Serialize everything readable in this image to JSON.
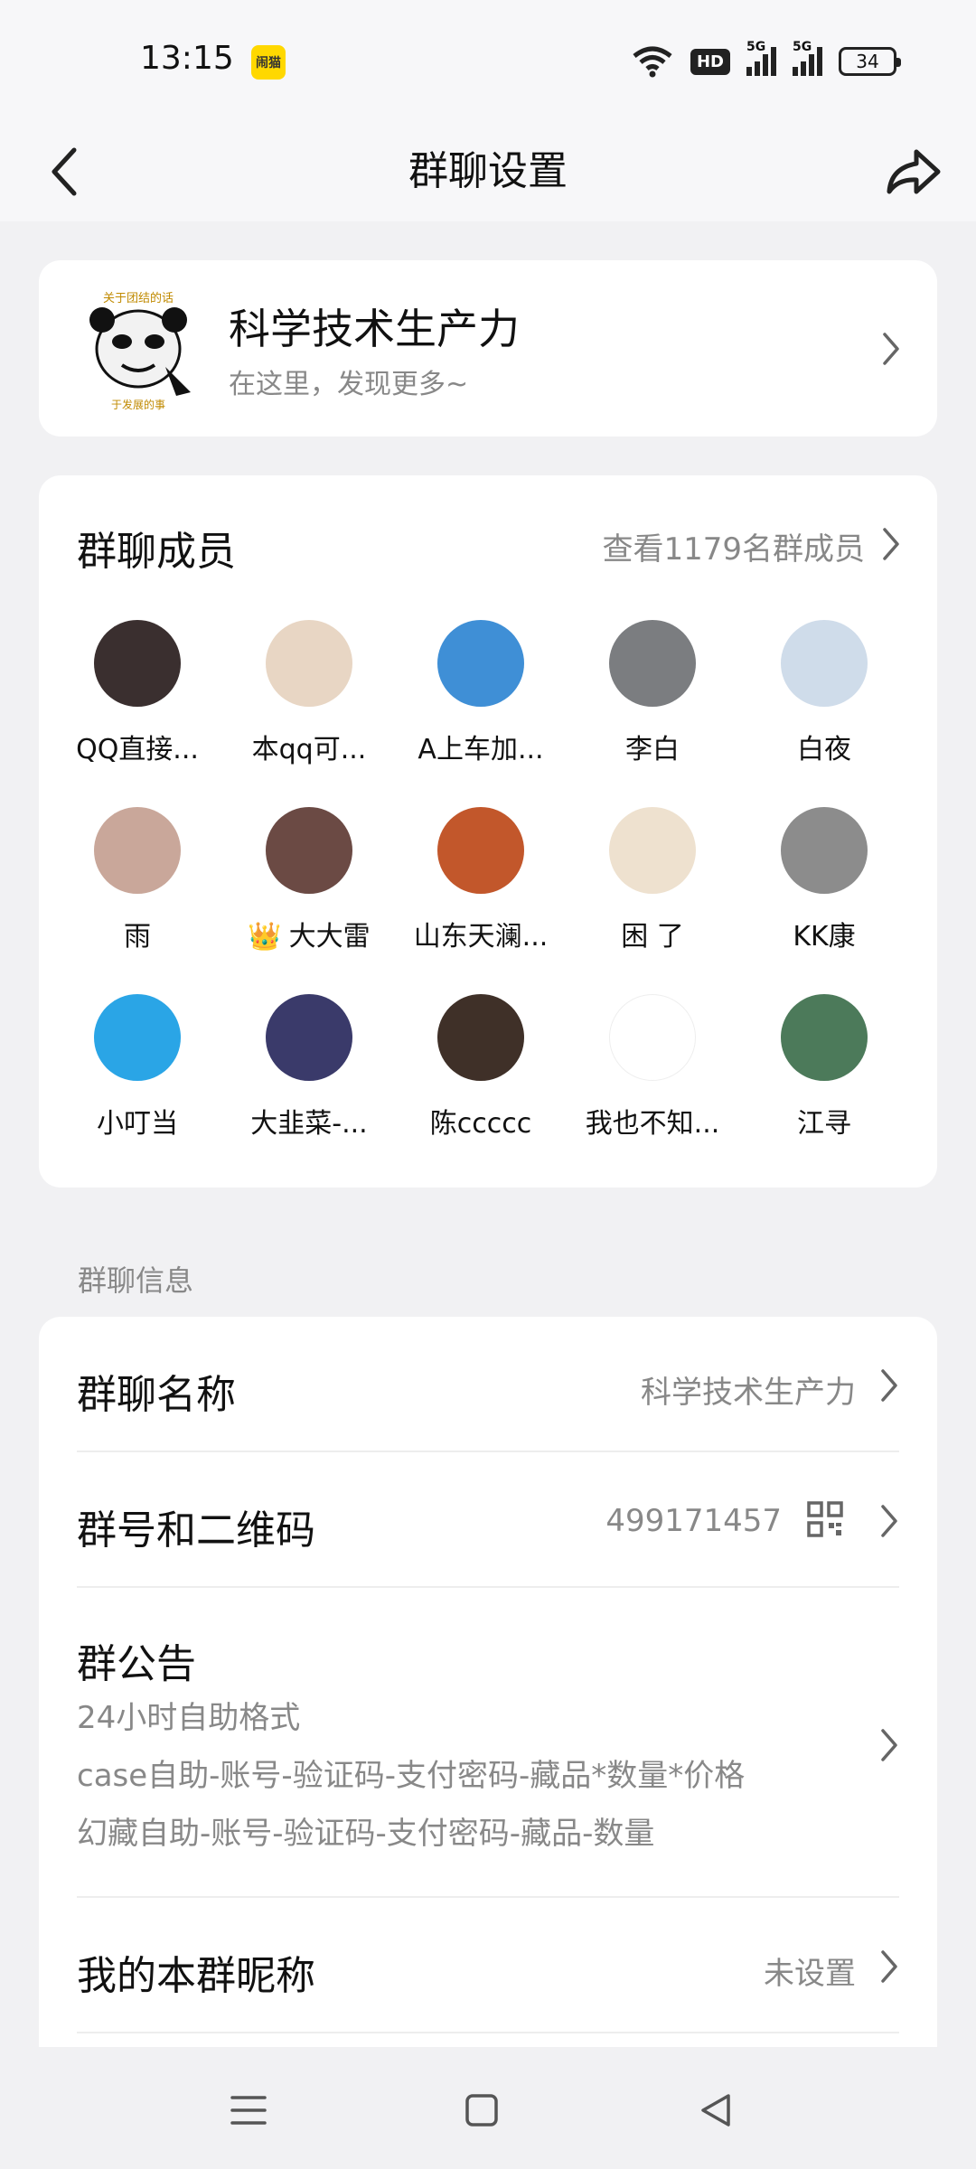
{
  "status": {
    "time": "13:15",
    "notif_badge": "闹猫",
    "hd": "HD",
    "signal1": "5G",
    "signal2": "5G",
    "battery": "34"
  },
  "header": {
    "title": "群聊设置"
  },
  "group": {
    "name": "科学技术生产力",
    "desc": "在这里，发现更多~",
    "avatar_text_top": "关于团结的话",
    "avatar_text_bottom": "于发展的事"
  },
  "members": {
    "title": "群聊成员",
    "view_all": "查看1179名群成员",
    "list": [
      {
        "name": "QQ直接...",
        "color": "#3a2f2f"
      },
      {
        "name": "本qq可...",
        "color": "#e8d6c4"
      },
      {
        "name": "A上车加...",
        "color": "#3f8fd6"
      },
      {
        "name": "李白",
        "color": "#7b7d80"
      },
      {
        "name": "白夜",
        "color": "#cfdcea"
      },
      {
        "name": "雨",
        "color": "#c9a79a"
      },
      {
        "name": "大大雷",
        "crown": "👑",
        "color": "#6b4a44"
      },
      {
        "name": "山东天澜...",
        "color": "#c2572b"
      },
      {
        "name": "困   了",
        "color": "#eee1cf"
      },
      {
        "name": "KK康",
        "color": "#8c8c8c"
      },
      {
        "name": "小叮当",
        "color": "#2aa5e6"
      },
      {
        "name": "大韭菜-...",
        "color": "#3a3a6a"
      },
      {
        "name": "陈ccccc",
        "color": "#3f3028"
      },
      {
        "name": "我也不知...",
        "color": "#ffffff"
      },
      {
        "name": "江寻",
        "color": "#4c7a5a"
      }
    ]
  },
  "info": {
    "section_label": "群聊信息",
    "group_name_label": "群聊名称",
    "group_name_value": "科学技术生产力",
    "group_id_label": "群号和二维码",
    "group_id_value": "499171457",
    "announce_label": "群公告",
    "announce_lines": [
      "24小时自助格式",
      "case自助-账号-验证码-支付密码-藏品*数量*价格",
      "幻藏自助-账号-验证码-支付密码-藏品-数量"
    ],
    "nickname_label": "我的本群昵称",
    "nickname_value": "未设置"
  }
}
